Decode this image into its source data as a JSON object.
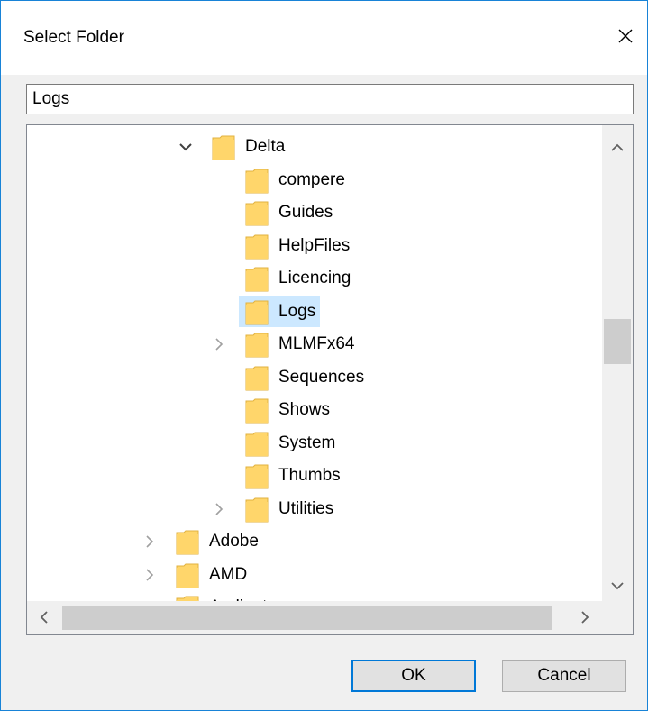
{
  "dialog": {
    "title": "Select Folder",
    "close_icon": "close-x-icon"
  },
  "path_input": {
    "value": "Logs"
  },
  "tree": {
    "parent": {
      "label": "Delta",
      "state": "expanded"
    },
    "children": [
      {
        "label": "compere",
        "expandable": false,
        "selected": false
      },
      {
        "label": "Guides",
        "expandable": false,
        "selected": false
      },
      {
        "label": "HelpFiles",
        "expandable": false,
        "selected": false
      },
      {
        "label": "Licencing",
        "expandable": false,
        "selected": false
      },
      {
        "label": "Logs",
        "expandable": false,
        "selected": true
      },
      {
        "label": "MLMFx64",
        "expandable": true,
        "selected": false
      },
      {
        "label": "Sequences",
        "expandable": false,
        "selected": false
      },
      {
        "label": "Shows",
        "expandable": false,
        "selected": false
      },
      {
        "label": "System",
        "expandable": false,
        "selected": false
      },
      {
        "label": "Thumbs",
        "expandable": false,
        "selected": false
      },
      {
        "label": "Utilities",
        "expandable": true,
        "selected": false
      }
    ],
    "siblings": [
      {
        "label": "Adobe",
        "expandable": true
      },
      {
        "label": "AMD",
        "expandable": true
      },
      {
        "label": "Audinate",
        "expandable": true
      }
    ],
    "selection_color": "#cce8ff",
    "folder_color": "#ffd66b"
  },
  "buttons": {
    "ok": "OK",
    "cancel": "Cancel"
  },
  "colors": {
    "accent": "#0078d7",
    "window_border": "#1883d7"
  }
}
